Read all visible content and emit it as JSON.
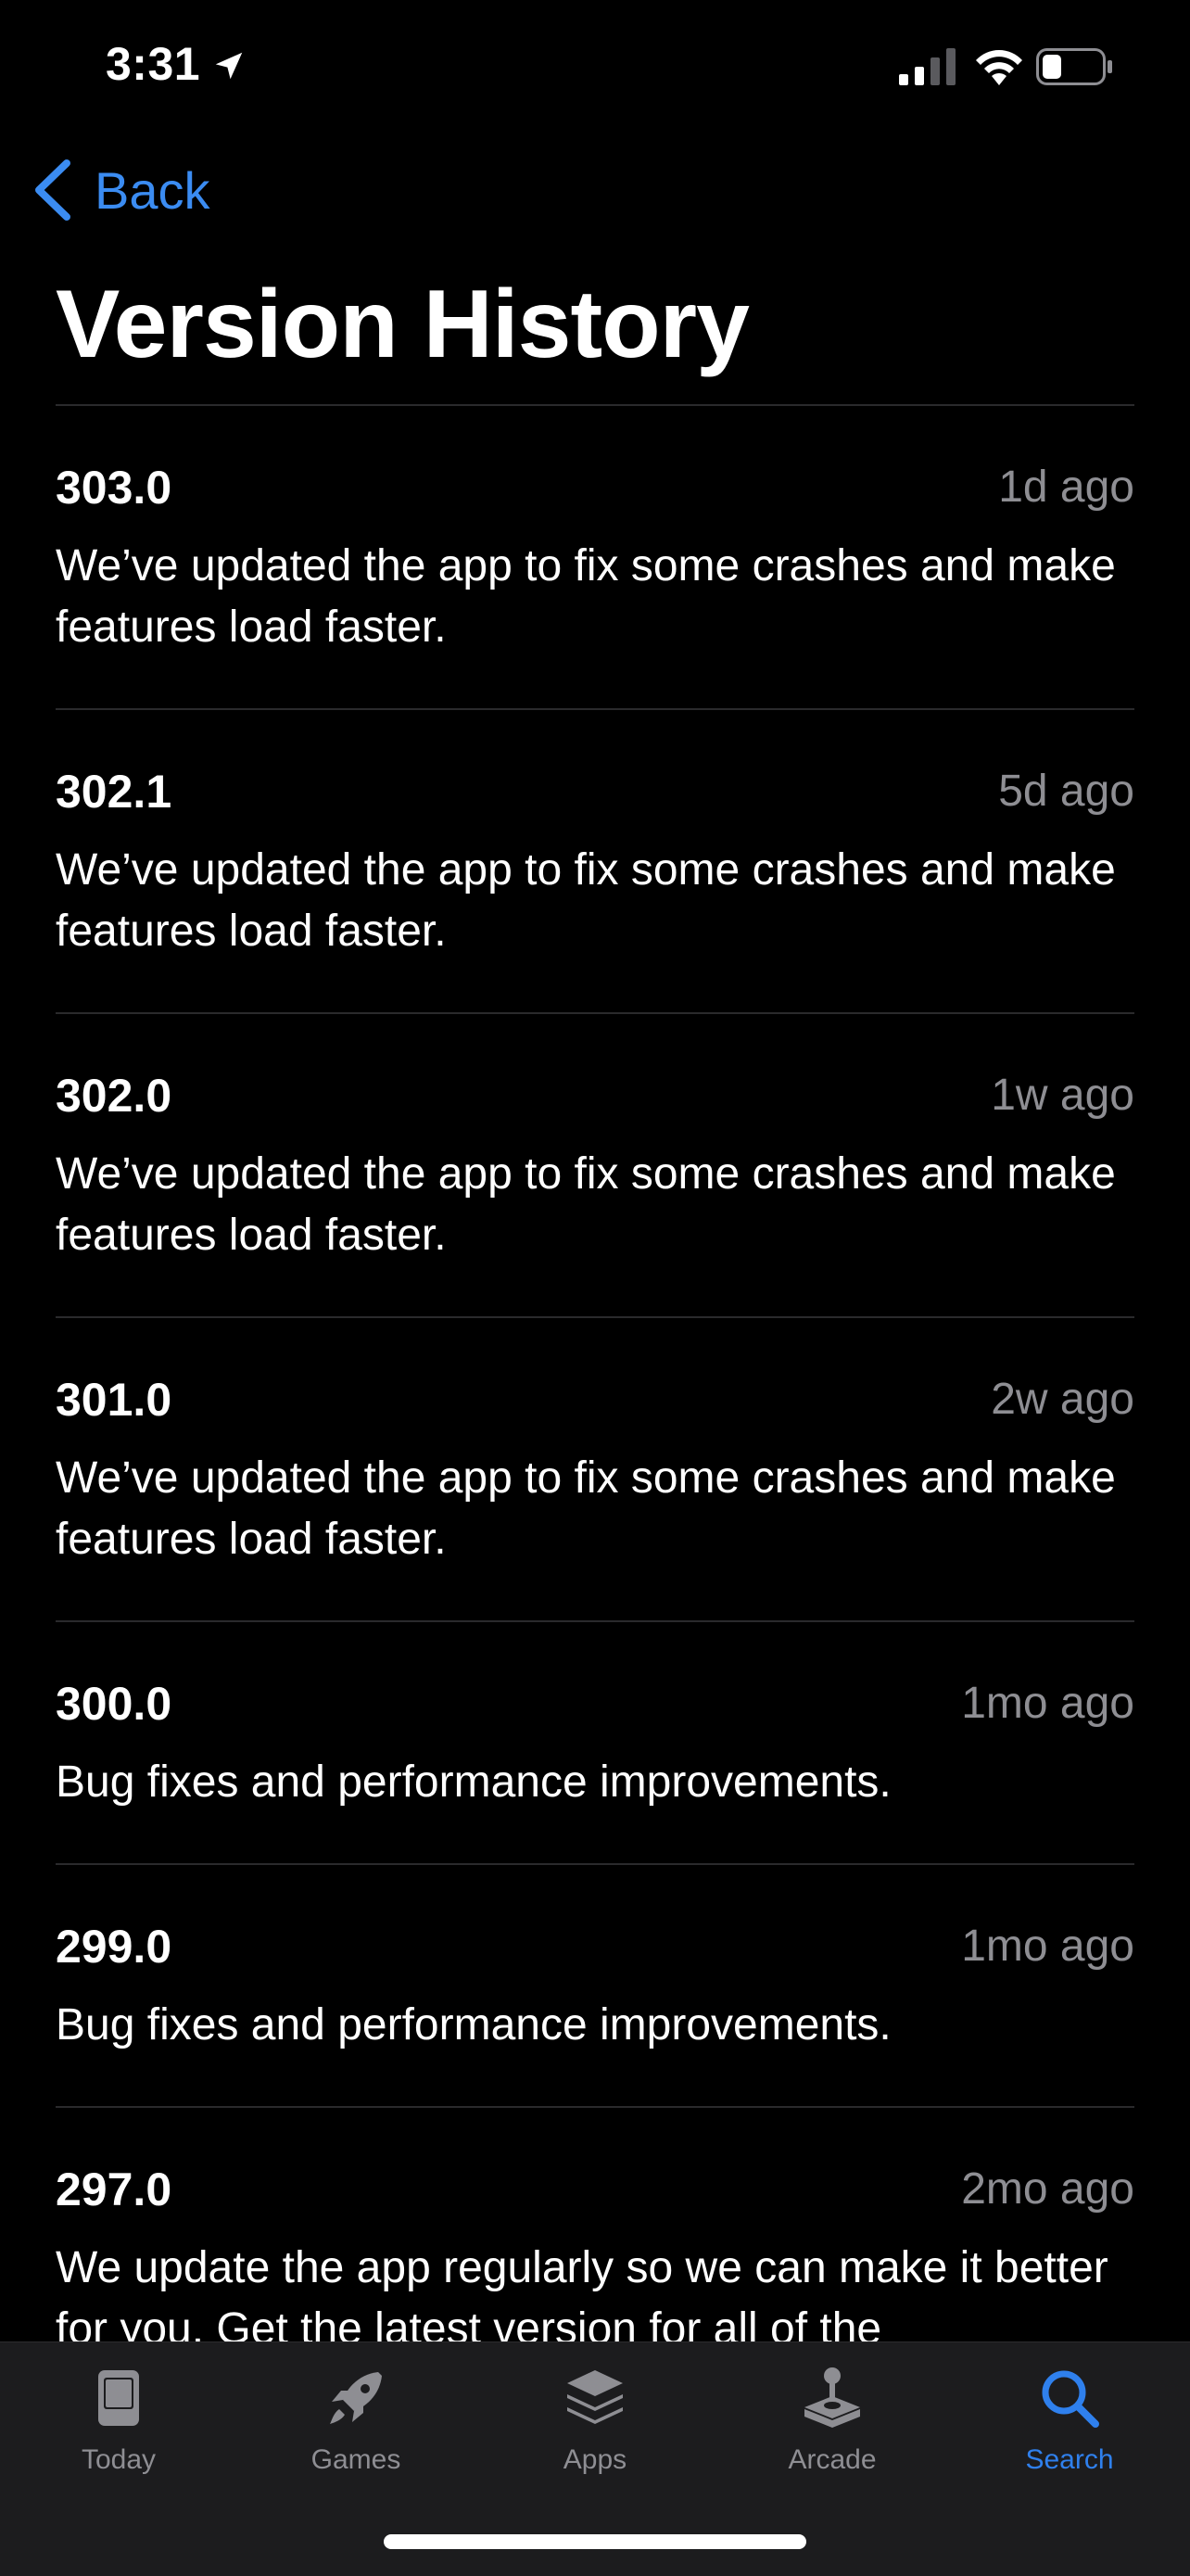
{
  "status_bar": {
    "time": "3:31",
    "icons": [
      "location-arrow-icon",
      "cellular-signal-icon",
      "wifi-icon",
      "battery-icon"
    ]
  },
  "nav": {
    "back_label": "Back"
  },
  "page": {
    "title": "Version History"
  },
  "versions": [
    {
      "number": "303.0",
      "date": "1d ago",
      "notes": "We’ve updated the app to fix some crashes and make features load faster."
    },
    {
      "number": "302.1",
      "date": "5d ago",
      "notes": "We’ve updated the app to fix some crashes and make features load faster."
    },
    {
      "number": "302.0",
      "date": "1w ago",
      "notes": "We’ve updated the app to fix some crashes and make features load faster."
    },
    {
      "number": "301.0",
      "date": "2w ago",
      "notes": "We’ve updated the app to fix some crashes and make features load faster."
    },
    {
      "number": "300.0",
      "date": "1mo ago",
      "notes": "Bug fixes and performance improvements."
    },
    {
      "number": "299.0",
      "date": "1mo ago",
      "notes": "Bug fixes and performance improvements."
    },
    {
      "number": "297.0",
      "date": "2mo ago",
      "notes": "We update the app regularly so we can make it better for you. Get the latest version for all of the"
    }
  ],
  "tab_bar": {
    "tabs": [
      {
        "label": "Today",
        "icon": "today-icon"
      },
      {
        "label": "Games",
        "icon": "rocket-icon"
      },
      {
        "label": "Apps",
        "icon": "apps-stack-icon"
      },
      {
        "label": "Arcade",
        "icon": "joystick-icon"
      },
      {
        "label": "Search",
        "icon": "search-icon"
      }
    ],
    "active": "Search"
  },
  "colors": {
    "background": "#000000",
    "accent": "#2f80ed",
    "secondary_text": "#8e8e93",
    "separator": "#2a2a2c",
    "tab_bar_bg": "#1c1c1e"
  }
}
